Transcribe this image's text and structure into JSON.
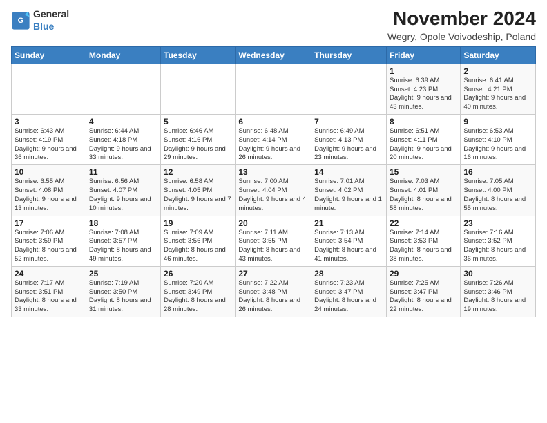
{
  "logo": {
    "general": "General",
    "blue": "Blue"
  },
  "title": "November 2024",
  "subtitle": "Wegry, Opole Voivodeship, Poland",
  "weekdays": [
    "Sunday",
    "Monday",
    "Tuesday",
    "Wednesday",
    "Thursday",
    "Friday",
    "Saturday"
  ],
  "weeks": [
    [
      {
        "day": "",
        "info": ""
      },
      {
        "day": "",
        "info": ""
      },
      {
        "day": "",
        "info": ""
      },
      {
        "day": "",
        "info": ""
      },
      {
        "day": "",
        "info": ""
      },
      {
        "day": "1",
        "info": "Sunrise: 6:39 AM\nSunset: 4:23 PM\nDaylight: 9 hours\nand 43 minutes."
      },
      {
        "day": "2",
        "info": "Sunrise: 6:41 AM\nSunset: 4:21 PM\nDaylight: 9 hours\nand 40 minutes."
      }
    ],
    [
      {
        "day": "3",
        "info": "Sunrise: 6:43 AM\nSunset: 4:19 PM\nDaylight: 9 hours\nand 36 minutes."
      },
      {
        "day": "4",
        "info": "Sunrise: 6:44 AM\nSunset: 4:18 PM\nDaylight: 9 hours\nand 33 minutes."
      },
      {
        "day": "5",
        "info": "Sunrise: 6:46 AM\nSunset: 4:16 PM\nDaylight: 9 hours\nand 29 minutes."
      },
      {
        "day": "6",
        "info": "Sunrise: 6:48 AM\nSunset: 4:14 PM\nDaylight: 9 hours\nand 26 minutes."
      },
      {
        "day": "7",
        "info": "Sunrise: 6:49 AM\nSunset: 4:13 PM\nDaylight: 9 hours\nand 23 minutes."
      },
      {
        "day": "8",
        "info": "Sunrise: 6:51 AM\nSunset: 4:11 PM\nDaylight: 9 hours\nand 20 minutes."
      },
      {
        "day": "9",
        "info": "Sunrise: 6:53 AM\nSunset: 4:10 PM\nDaylight: 9 hours\nand 16 minutes."
      }
    ],
    [
      {
        "day": "10",
        "info": "Sunrise: 6:55 AM\nSunset: 4:08 PM\nDaylight: 9 hours\nand 13 minutes."
      },
      {
        "day": "11",
        "info": "Sunrise: 6:56 AM\nSunset: 4:07 PM\nDaylight: 9 hours\nand 10 minutes."
      },
      {
        "day": "12",
        "info": "Sunrise: 6:58 AM\nSunset: 4:05 PM\nDaylight: 9 hours\nand 7 minutes."
      },
      {
        "day": "13",
        "info": "Sunrise: 7:00 AM\nSunset: 4:04 PM\nDaylight: 9 hours\nand 4 minutes."
      },
      {
        "day": "14",
        "info": "Sunrise: 7:01 AM\nSunset: 4:02 PM\nDaylight: 9 hours\nand 1 minute."
      },
      {
        "day": "15",
        "info": "Sunrise: 7:03 AM\nSunset: 4:01 PM\nDaylight: 8 hours\nand 58 minutes."
      },
      {
        "day": "16",
        "info": "Sunrise: 7:05 AM\nSunset: 4:00 PM\nDaylight: 8 hours\nand 55 minutes."
      }
    ],
    [
      {
        "day": "17",
        "info": "Sunrise: 7:06 AM\nSunset: 3:59 PM\nDaylight: 8 hours\nand 52 minutes."
      },
      {
        "day": "18",
        "info": "Sunrise: 7:08 AM\nSunset: 3:57 PM\nDaylight: 8 hours\nand 49 minutes."
      },
      {
        "day": "19",
        "info": "Sunrise: 7:09 AM\nSunset: 3:56 PM\nDaylight: 8 hours\nand 46 minutes."
      },
      {
        "day": "20",
        "info": "Sunrise: 7:11 AM\nSunset: 3:55 PM\nDaylight: 8 hours\nand 43 minutes."
      },
      {
        "day": "21",
        "info": "Sunrise: 7:13 AM\nSunset: 3:54 PM\nDaylight: 8 hours\nand 41 minutes."
      },
      {
        "day": "22",
        "info": "Sunrise: 7:14 AM\nSunset: 3:53 PM\nDaylight: 8 hours\nand 38 minutes."
      },
      {
        "day": "23",
        "info": "Sunrise: 7:16 AM\nSunset: 3:52 PM\nDaylight: 8 hours\nand 36 minutes."
      }
    ],
    [
      {
        "day": "24",
        "info": "Sunrise: 7:17 AM\nSunset: 3:51 PM\nDaylight: 8 hours\nand 33 minutes."
      },
      {
        "day": "25",
        "info": "Sunrise: 7:19 AM\nSunset: 3:50 PM\nDaylight: 8 hours\nand 31 minutes."
      },
      {
        "day": "26",
        "info": "Sunrise: 7:20 AM\nSunset: 3:49 PM\nDaylight: 8 hours\nand 28 minutes."
      },
      {
        "day": "27",
        "info": "Sunrise: 7:22 AM\nSunset: 3:48 PM\nDaylight: 8 hours\nand 26 minutes."
      },
      {
        "day": "28",
        "info": "Sunrise: 7:23 AM\nSunset: 3:47 PM\nDaylight: 8 hours\nand 24 minutes."
      },
      {
        "day": "29",
        "info": "Sunrise: 7:25 AM\nSunset: 3:47 PM\nDaylight: 8 hours\nand 22 minutes."
      },
      {
        "day": "30",
        "info": "Sunrise: 7:26 AM\nSunset: 3:46 PM\nDaylight: 8 hours\nand 19 minutes."
      }
    ]
  ]
}
